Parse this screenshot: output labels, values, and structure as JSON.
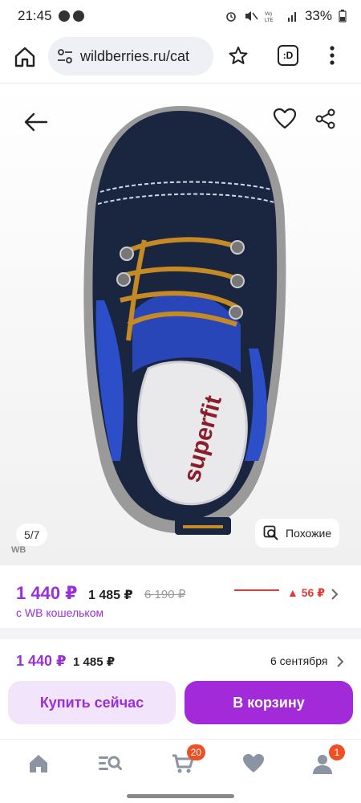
{
  "status": {
    "time": "21:45",
    "battery": "33%"
  },
  "browser": {
    "url": "wildberries.ru/cat",
    "tabs_label": ":D"
  },
  "gallery": {
    "counter": "5/7",
    "wb_mark": "WB",
    "similar_label": "Похожие",
    "shoe_brand": "superfit"
  },
  "price": {
    "current": "1 440 ₽",
    "secondary": "1 485 ₽",
    "old": "6 190 ₽",
    "wallet_note": "с WB кошельком",
    "delta": "▲ 56 ₽"
  },
  "purchase": {
    "current": "1 440 ₽",
    "secondary": "1 485 ₽",
    "delivery_date": "6 сентября",
    "buy_now_label": "Купить сейчас",
    "add_to_cart_label": "В корзину"
  },
  "nav": {
    "cart_badge": "20",
    "profile_badge": "1"
  },
  "colors": {
    "accent": "#9a2fd8",
    "cart_button": "#a32ad8",
    "badge": "#f04e23",
    "delta": "#e53935"
  }
}
